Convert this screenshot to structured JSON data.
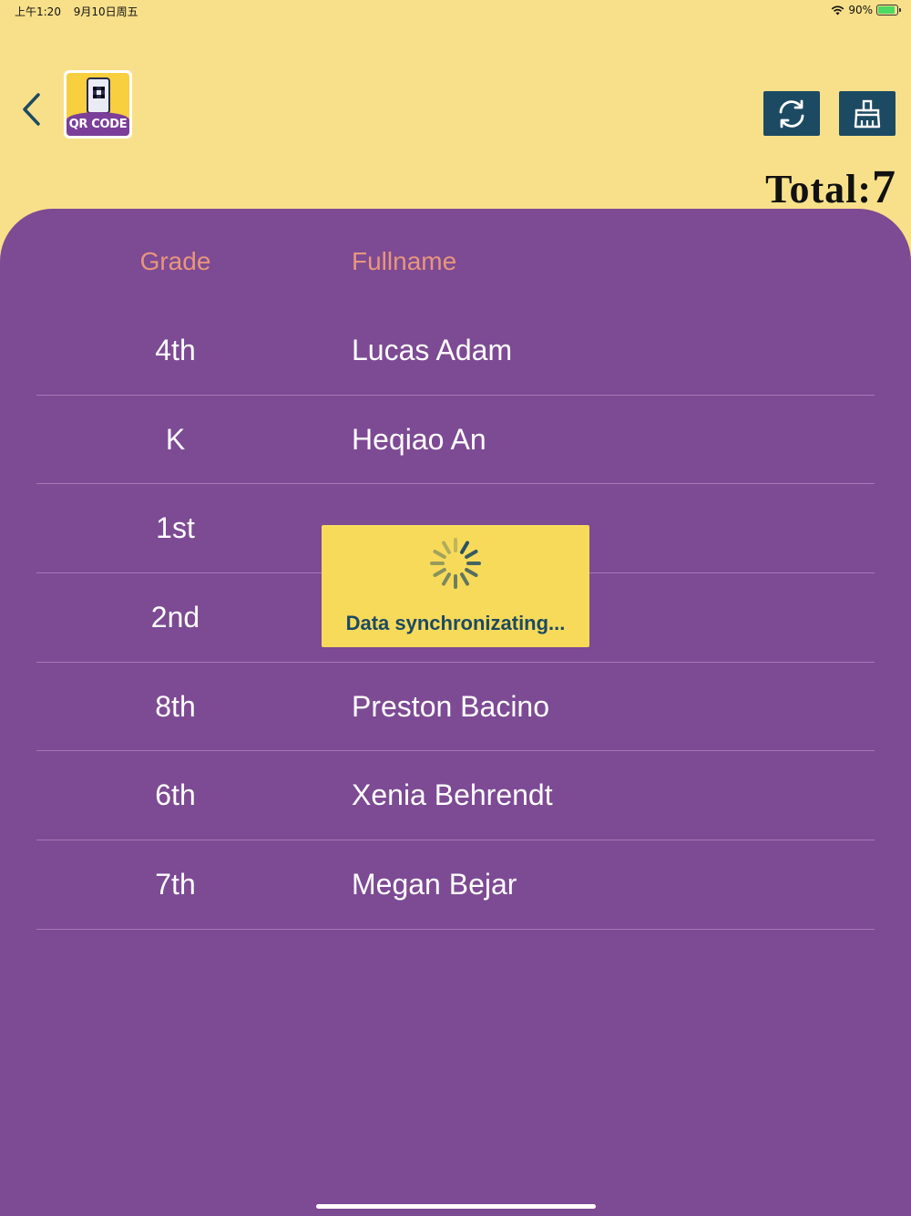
{
  "status_bar": {
    "time": "上午1:20",
    "date": "9月10日周五",
    "battery_percent": "90%",
    "battery_level": 0.9
  },
  "header": {
    "logo_text": "QR CODE",
    "total_label": "Total:",
    "total_value": "7"
  },
  "table": {
    "columns": {
      "grade": "Grade",
      "fullname": "Fullname"
    },
    "rows": [
      {
        "grade": "4th",
        "name": "Lucas Adam"
      },
      {
        "grade": "K",
        "name": "Heqiao An"
      },
      {
        "grade": "1st",
        "name": ""
      },
      {
        "grade": "2nd",
        "name": ""
      },
      {
        "grade": "8th",
        "name": "Preston Bacino"
      },
      {
        "grade": "6th",
        "name": "Xenia Behrendt"
      },
      {
        "grade": "7th",
        "name": "Megan Bejar"
      }
    ]
  },
  "toast": {
    "message": "Data synchronizating..."
  },
  "icons": {
    "back": "chevron-left-icon",
    "refresh": "refresh-icon",
    "clean": "broom-icon",
    "wifi": "wifi-icon",
    "battery": "battery-icon",
    "spinner": "spinner-icon"
  },
  "colors": {
    "background": "#f8e08a",
    "panel": "#7d4a94",
    "header_text": "#e7967c",
    "button": "#1c4a63",
    "toast": "#f7da5a"
  }
}
